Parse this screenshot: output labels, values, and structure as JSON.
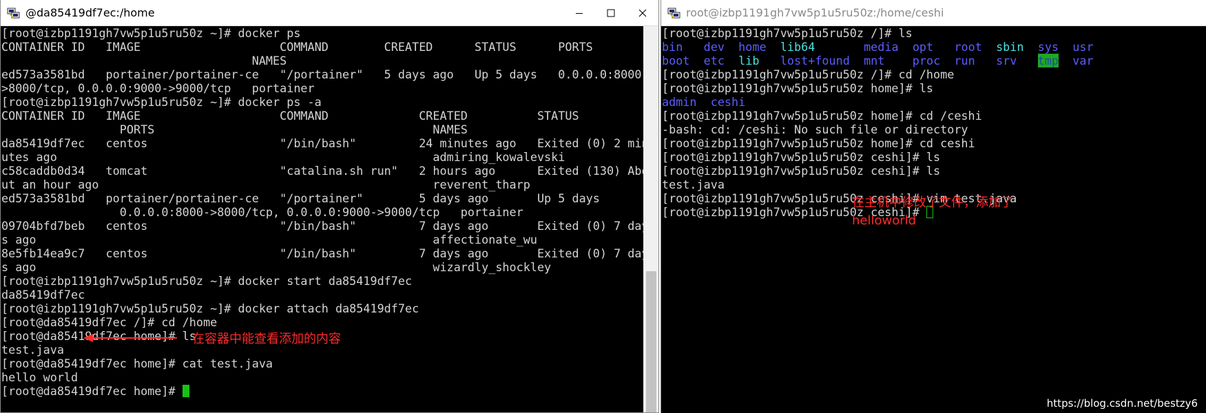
{
  "left_window": {
    "title": "@da85419df7ec:/home",
    "icons": {
      "app": "putty-icon",
      "minimize": "minimize-icon",
      "maximize": "maximize-icon",
      "close": "close-icon"
    },
    "lines": [
      "[root@izbp1191gh7vw5p1u5ru50z ~]# docker ps",
      "CONTAINER ID   IMAGE                    COMMAND        CREATED      STATUS      PORTS",
      "                                    NAMES",
      "ed573a3581bd   portainer/portainer-ce   \"/portainer\"   5 days ago   Up 5 days   0.0.0.0:8000-",
      ">8000/tcp, 0.0.0.0:9000->9000/tcp   portainer",
      "[root@izbp1191gh7vw5p1u5ru50z ~]# docker ps -a",
      "CONTAINER ID   IMAGE                    COMMAND             CREATED          STATUS",
      "                 PORTS                                        NAMES",
      "da85419df7ec   centos                   \"/bin/bash\"         24 minutes ago   Exited (0) 2 min",
      "utes ago                                                      admiring_kowalevski",
      "c58caddb0d34   tomcat                   \"catalina.sh run\"   2 hours ago      Exited (130) Abo",
      "ut an hour ago                                                reverent_tharp",
      "ed573a3581bd   portainer/portainer-ce   \"/portainer\"        5 days ago       Up 5 days",
      "                 0.0.0.0:8000->8000/tcp, 0.0.0.0:9000->9000/tcp   portainer",
      "09704bfd7beb   centos                   \"/bin/bash\"         7 days ago       Exited (0) 7 day",
      "s ago                                                         affectionate_wu",
      "8e5fb14ea9c7   centos                   \"/bin/bash\"         7 days ago       Exited (0) 7 day",
      "s ago                                                         wizardly_shockley",
      "[root@izbp1191gh7vw5p1u5ru50z ~]# docker start da85419df7ec",
      "da85419df7ec",
      "[root@izbp1191gh7vw5p1u5ru50z ~]# docker attach da85419df7ec",
      "[root@da85419df7ec /]# cd /home",
      "[root@da85419df7ec home]# ls",
      "test.java",
      "[root@da85419df7ec home]# cat test.java",
      "hello world"
    ],
    "prompt_line": "[root@da85419df7ec home]# ",
    "annotation": "在容器中能查看添加的内容"
  },
  "right_window": {
    "title": "root@izbp1191gh7vw5p1u5ru50z:/home/ceshi",
    "icons": {
      "app": "putty-icon"
    },
    "line_1": "[root@izbp1191gh7vw5p1u5ru50z /]# ls",
    "ls_root_rows": [
      [
        {
          "t": "bin",
          "c": "blue"
        },
        {
          "t": "   "
        },
        {
          "t": "dev",
          "c": "blue"
        },
        {
          "t": "  "
        },
        {
          "t": "home",
          "c": "blue"
        },
        {
          "t": "  "
        },
        {
          "t": "lib64",
          "c": "cyan"
        },
        {
          "t": "       "
        },
        {
          "t": "media",
          "c": "blue"
        },
        {
          "t": "  "
        },
        {
          "t": "opt",
          "c": "blue"
        },
        {
          "t": "   "
        },
        {
          "t": "root",
          "c": "blue"
        },
        {
          "t": "  "
        },
        {
          "t": "sbin",
          "c": "cyan"
        },
        {
          "t": "  "
        },
        {
          "t": "sys",
          "c": "blue"
        },
        {
          "t": "  "
        },
        {
          "t": "usr",
          "c": "blue"
        }
      ],
      [
        {
          "t": "boot",
          "c": "blue"
        },
        {
          "t": "  "
        },
        {
          "t": "etc",
          "c": "blue"
        },
        {
          "t": "  "
        },
        {
          "t": "lib",
          "c": "cyan"
        },
        {
          "t": "   "
        },
        {
          "t": "lost+found",
          "c": "blue"
        },
        {
          "t": "  "
        },
        {
          "t": "mnt",
          "c": "blue"
        },
        {
          "t": "    "
        },
        {
          "t": "proc",
          "c": "blue"
        },
        {
          "t": "  "
        },
        {
          "t": "run",
          "c": "blue"
        },
        {
          "t": "   "
        },
        {
          "t": "srv",
          "c": "blue"
        },
        {
          "t": "   "
        },
        {
          "t": "tmp",
          "c": "tmp"
        },
        {
          "t": "  "
        },
        {
          "t": "var",
          "c": "blue"
        }
      ]
    ],
    "lines_after_ls": [
      {
        "t": "[root@izbp1191gh7vw5p1u5ru50z /]# cd /home"
      },
      {
        "t": "[root@izbp1191gh7vw5p1u5ru50z home]# ls"
      },
      {
        "t": "admin  ceshi",
        "c": "blue"
      },
      {
        "t": "[root@izbp1191gh7vw5p1u5ru50z home]# cd /ceshi"
      },
      {
        "t": "-bash: cd: /ceshi: No such file or directory"
      },
      {
        "t": "[root@izbp1191gh7vw5p1u5ru50z home]# cd ceshi"
      },
      {
        "t": "[root@izbp1191gh7vw5p1u5ru50z ceshi]# ls"
      },
      {
        "t": "[root@izbp1191gh7vw5p1u5ru50z ceshi]# ls"
      },
      {
        "t": "test.java"
      },
      {
        "t": "[root@izbp1191gh7vw5p1u5ru50z ceshi]# vim test.java"
      }
    ],
    "prompt_line": "[root@izbp1191gh7vw5p1u5ru50z ceshi]# ",
    "annotation_lines": [
      "在主机中修改了文件，添加了",
      "helloworld"
    ]
  },
  "watermark": "https://blog.csdn.net/bestzy6",
  "colors": {
    "blue": "#5c5cff",
    "cyan": "#49e0e0",
    "tmp_fg": "#1e4ab0",
    "tmp_bg": "#1fa81f",
    "cursor": "#17c217",
    "annotation": "#ff2a2a"
  }
}
